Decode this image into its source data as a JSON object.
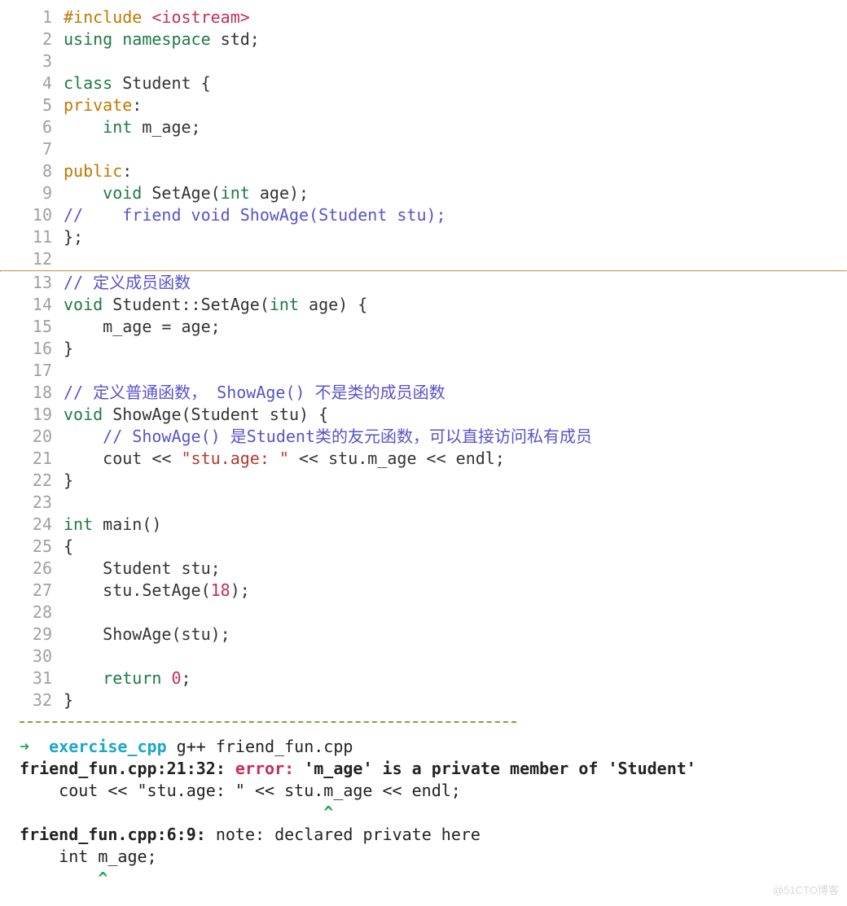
{
  "code": {
    "1": {
      "pre": "#include ",
      "hdr": "<iostream>"
    },
    "2": {
      "kw1": "using ",
      "kw2": "namespace ",
      "rest": "std;"
    },
    "3": "",
    "4": {
      "kw": "class ",
      "rest": "Student {"
    },
    "5": {
      "acc": "private",
      "colon": ":"
    },
    "6": {
      "indent": "    ",
      "kw": "int ",
      "rest": "m_age;"
    },
    "7": "",
    "8": {
      "acc": "public",
      "colon": ":"
    },
    "9": {
      "indent": "    ",
      "kw1": "void ",
      "name": "SetAge(",
      "kw2": "int ",
      "rest": "age);"
    },
    "10": {
      "cmt": "//    friend void ShowAge(Student stu);"
    },
    "11": "};",
    "12": "",
    "13": {
      "cmt": "// 定义成员函数"
    },
    "14": {
      "kw": "void ",
      "name": "Student::SetAge(",
      "kw2": "int ",
      "rest": "age) {"
    },
    "15": "    m_age = age;",
    "16": "}",
    "17": "",
    "18": {
      "cmt": "// 定义普通函数， ShowAge() 不是类的成员函数"
    },
    "19": {
      "kw": "void ",
      "rest": "ShowAge(Student stu) {"
    },
    "20": {
      "indent": "    ",
      "cmt": "// ShowAge() 是Student类的友元函数，可以直接访问私有成员"
    },
    "21": {
      "indent": "    cout << ",
      "str": "\"stu.age: \"",
      "rest": " << stu.m_age << endl;"
    },
    "22": "}",
    "23": "",
    "24": {
      "kw": "int ",
      "rest": "main()"
    },
    "25": "{",
    "26": "    Student stu;",
    "27": {
      "indent": "    stu.SetAge(",
      "num": "18",
      "rest": ");"
    },
    "28": "",
    "29": "    ShowAge(stu);",
    "30": "",
    "31": {
      "indent": "    ",
      "kw": "return ",
      "num": "0",
      "rest": ";"
    },
    "32": "}"
  },
  "terminal": {
    "arrow": "➜  ",
    "dir": "exercise_cpp",
    "cmd": " g++ friend_fun.cpp",
    "line2a": "friend_fun.cpp:21:32: ",
    "err": "error:",
    "line2b": " 'm_age' is a private member of 'Student'",
    "line3": "    cout << \"stu.age: \" << stu.m_age << endl;",
    "caret1": "                               ^",
    "line5": "friend_fun.cpp:6:9: ",
    "note": "note: ",
    "line5b": "declared private here",
    "line6": "    int m_age;",
    "caret2": "        ^"
  },
  "watermark": "@51CTO博客"
}
